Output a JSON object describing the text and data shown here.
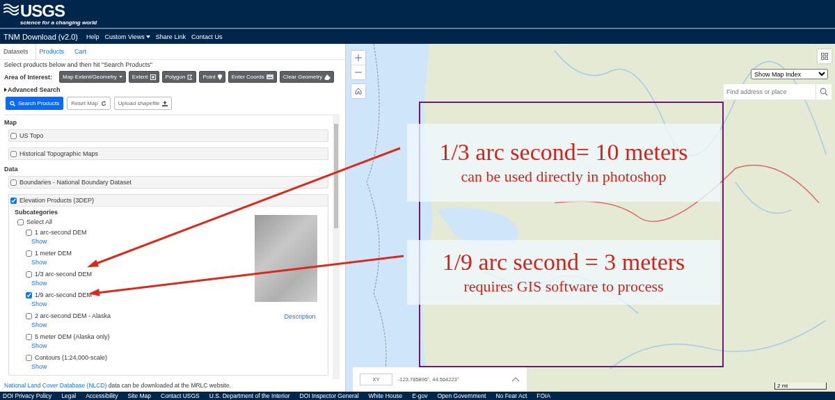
{
  "header": {
    "logo": "USGS",
    "tagline": "science for a changing world"
  },
  "nav": {
    "title": "TNM Download (v2.0)",
    "links": [
      {
        "label": "Help",
        "dropdown": false
      },
      {
        "label": "Custom Views",
        "dropdown": true
      },
      {
        "label": "Share Link",
        "dropdown": false
      },
      {
        "label": "Contact Us",
        "dropdown": false
      }
    ]
  },
  "tabs": [
    {
      "label": "Datasets",
      "selected": true
    },
    {
      "label": "Products",
      "selected": false
    },
    {
      "label": "Cart",
      "selected": false
    }
  ],
  "instructions": "Select products below and then hit \"Search Products\"",
  "area_of_interest": {
    "label": "Area of Interest:",
    "buttons": [
      {
        "label": "Map Extent/Geometry",
        "kind": "dropdown"
      },
      {
        "label": "Extent",
        "kind": "extent"
      },
      {
        "label": "Polygon",
        "kind": "polygon"
      },
      {
        "label": "Point",
        "kind": "point"
      },
      {
        "label": "Enter Coords",
        "kind": "coords"
      },
      {
        "label": "Clear Geometry",
        "kind": "clear"
      }
    ]
  },
  "advanced_search": {
    "label": "Advanced Search",
    "expanded": false
  },
  "action_buttons": [
    {
      "label": "Search Products",
      "kind": "primary"
    },
    {
      "label": "Reset Map",
      "kind": "reset"
    },
    {
      "label": "Upload shapefile",
      "kind": "upload"
    }
  ],
  "sections": [
    {
      "heading": "Map",
      "datasets": [
        {
          "label": "US Topo",
          "checked": false
        },
        {
          "label": "Historical Topographic Maps",
          "checked": false
        }
      ]
    },
    {
      "heading": "Data",
      "datasets": [
        {
          "label": "Boundaries - National Boundary Dataset",
          "checked": false
        },
        {
          "label": "Elevation Products (3DEP)",
          "checked": true,
          "subcategories": {
            "heading": "Subcategories",
            "select_all": {
              "label": "Select All",
              "checked": false
            },
            "description_link": "Description",
            "items": [
              {
                "label": "1 arc-second DEM",
                "checked": false,
                "link": "Show"
              },
              {
                "label": "1 meter DEM",
                "checked": false,
                "link": "Show"
              },
              {
                "label": "1/3 arc-second DEM",
                "checked": false,
                "link": "Show"
              },
              {
                "label": "1/9 arc-second DEM",
                "checked": true,
                "link": "Show"
              },
              {
                "label": "2 arc-second DEM - Alaska",
                "checked": false,
                "link": "Show"
              },
              {
                "label": "5 meter DEM (Alaska only)",
                "checked": false,
                "link": "Show"
              },
              {
                "label": "Contours (1:24,000-scale)",
                "checked": false,
                "link": "Show"
              }
            ]
          }
        }
      ]
    }
  ],
  "footnote": {
    "link": "National Land Cover Database (NLCD)",
    "text": "data can be downloaded at the MRLC website."
  },
  "map": {
    "index_select": "Show Map Index",
    "search": {
      "placeholder": "Find address or place"
    },
    "coords": {
      "label": "XY",
      "value": "-123.785896°, 44.564223°"
    },
    "scale": "2 mi",
    "annotations": [
      {
        "title": "1/3 arc second= 10 meters",
        "note": "can be used directly in photoshop"
      },
      {
        "title": "1/9 arc second = 3 meters",
        "note": "requires GIS software to process"
      }
    ]
  },
  "footer": {
    "links": [
      "DOI Privacy Policy",
      "Legal",
      "Accessibility",
      "Site Map",
      "Contact USGS",
      "U.S. Department of the Interior",
      "DOI Inspector General",
      "White House",
      "E-gov",
      "Open Government",
      "No Fear Act",
      "FOIA"
    ]
  }
}
